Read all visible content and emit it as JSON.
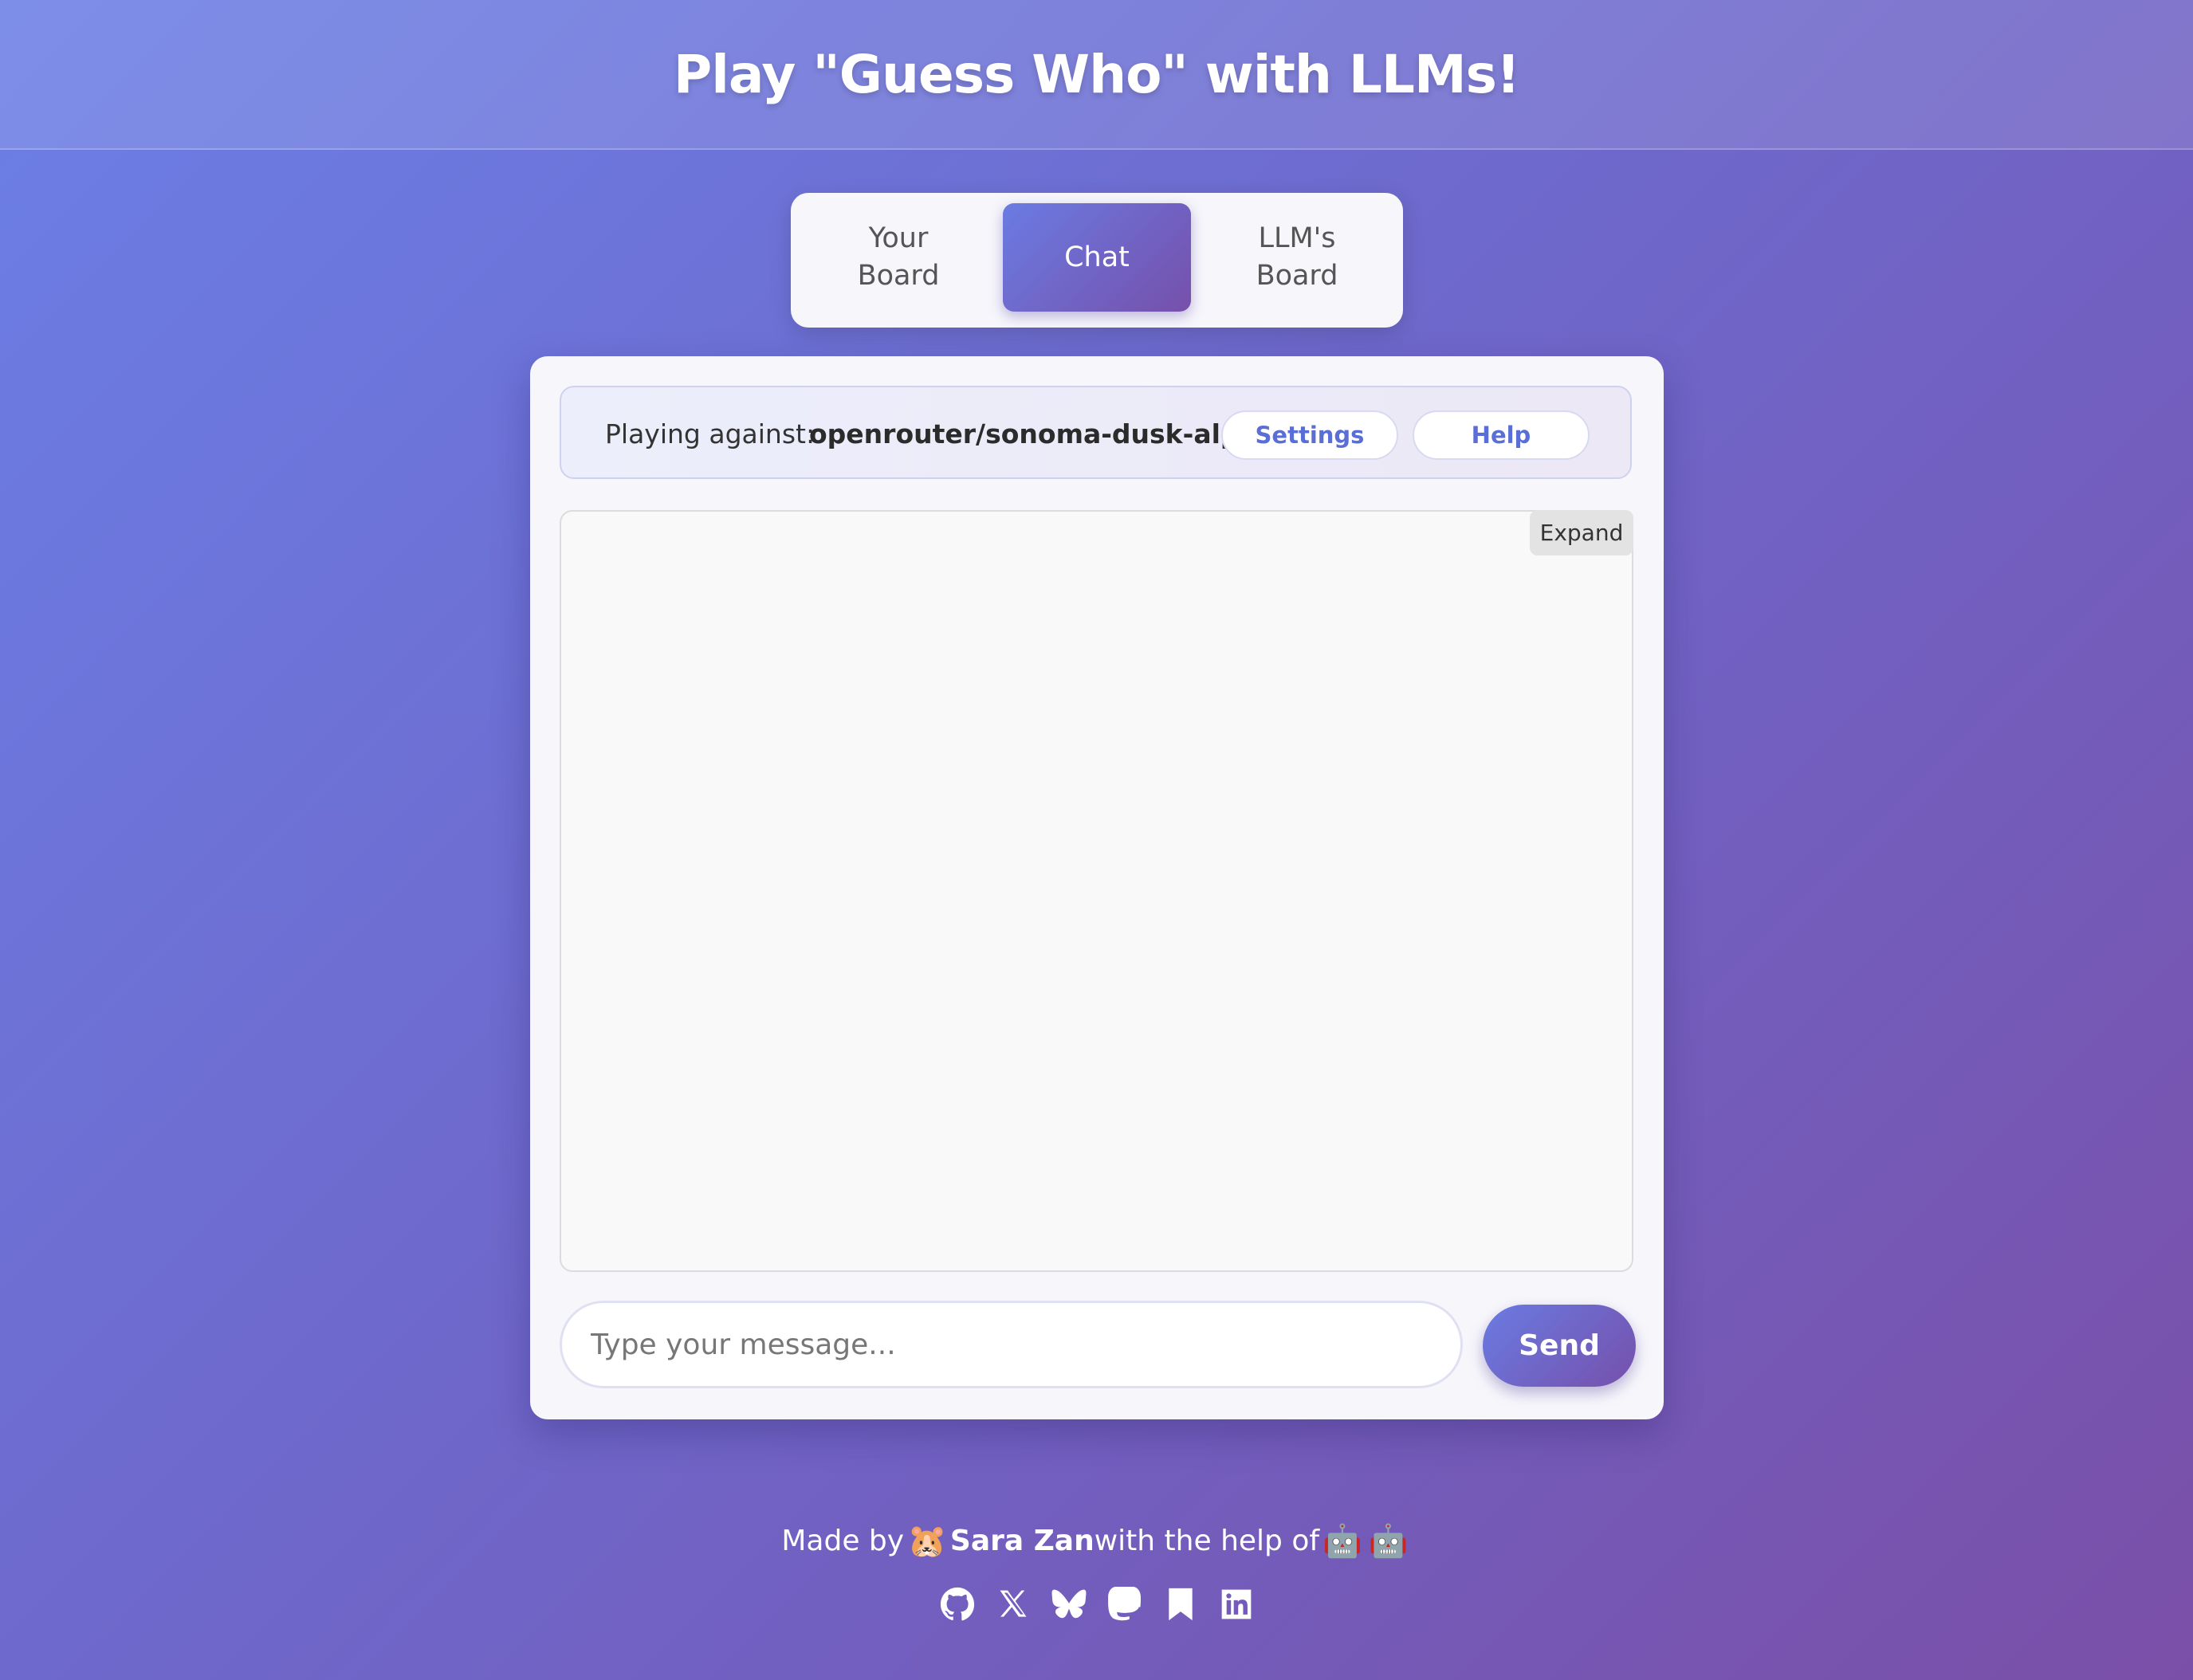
{
  "header": {
    "title": "Play \"Guess Who\" with LLMs!"
  },
  "tabs": [
    {
      "label": "Your Board",
      "active": false
    },
    {
      "label": "Chat",
      "active": true
    },
    {
      "label": "LLM's Board",
      "active": false
    }
  ],
  "game": {
    "opponent_label": "Playing against:",
    "opponent_model": "openrouter/sonoma-dusk-alpha",
    "settings_label": "Settings",
    "help_label": "Help"
  },
  "chat": {
    "expand_label": "Expand",
    "input_value": "",
    "input_placeholder": "Type your message...",
    "send_label": "Send"
  },
  "footer": {
    "made_by": "Made by",
    "author_emoji": "🐹",
    "author": "Sara Zan",
    "help_text": "with the help of",
    "robots": [
      "🤖",
      "🤖"
    ],
    "social_icons": [
      "github-icon",
      "x-icon",
      "bluesky-icon",
      "mastodon-icon",
      "bookmark-icon",
      "linkedin-icon"
    ]
  },
  "colors": {
    "accent_start": "#6a7be2",
    "accent_end": "#7650ab",
    "link_blue": "#5a6fd6"
  }
}
